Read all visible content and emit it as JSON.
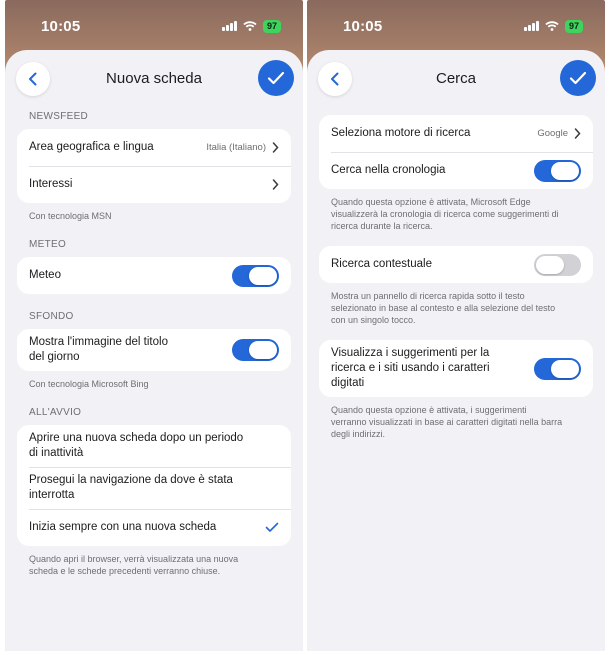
{
  "status": {
    "time": "10:05",
    "battery": "97"
  },
  "left": {
    "title": "Nuova scheda",
    "newsfeed": {
      "label": "NEWSFEED",
      "rows": [
        {
          "label": "Area geografica e lingua",
          "value": "Italia (Italiano)"
        },
        {
          "label": "Interessi"
        }
      ],
      "note": "Con tecnologia MSN"
    },
    "meteo": {
      "label": "METEO",
      "row": {
        "label": "Meteo",
        "toggle": "on"
      }
    },
    "sfondo": {
      "label": "SFONDO",
      "row": {
        "label_line1": "Mostra l'immagine del titolo",
        "label_line2": "del giorno",
        "toggle": "on"
      },
      "note": "Con tecnologia Microsoft Bing"
    },
    "avvio": {
      "label": "ALL'AVVIO",
      "rows": [
        {
          "label_line1": "Aprire una nuova scheda dopo un periodo",
          "label_line2": "di inattività"
        },
        {
          "label": "Prosegui la navigazione da dove è stata interrotta"
        },
        {
          "label": "Inizia sempre con una nuova scheda",
          "selected": true
        }
      ],
      "note_line1": "Quando apri il browser, verrà visualizzata una nuova",
      "note_line2": "scheda e le schede precedenti verranno chiuse."
    }
  },
  "right": {
    "title": "Cerca",
    "group1": {
      "rows": [
        {
          "label": "Seleziona motore di ricerca",
          "value": "Google"
        },
        {
          "label": "Cerca nella cronologia",
          "toggle": "on"
        }
      ],
      "note_line1": "Quando questa opzione è attivata, Microsoft Edge",
      "note_line2": "visualizzerà la cronologia di ricerca come suggerimenti di",
      "note_line3": "ricerca durante la ricerca."
    },
    "group2": {
      "row": {
        "label": "Ricerca contestuale",
        "toggle": "off"
      },
      "note_line1": "Mostra un pannello di ricerca rapida sotto il testo",
      "note_line2": "selezionato in base al contesto e alla selezione del testo",
      "note_line3": "con un singolo tocco."
    },
    "group3": {
      "row": {
        "label_line1": "Visualizza i suggerimenti per la",
        "label_line2": "ricerca e i siti usando i caratteri",
        "label_line3": "digitati",
        "toggle": "on"
      },
      "note_line1": "Quando questa opzione è attivata, i suggerimenti",
      "note_line2": "verranno visualizzati in base ai caratteri digitati nella barra",
      "note_line3": "degli indirizzi."
    }
  },
  "colors": {
    "accent": "#2367d8",
    "background": "#f2f2f6",
    "battery": "#3cd45a"
  }
}
